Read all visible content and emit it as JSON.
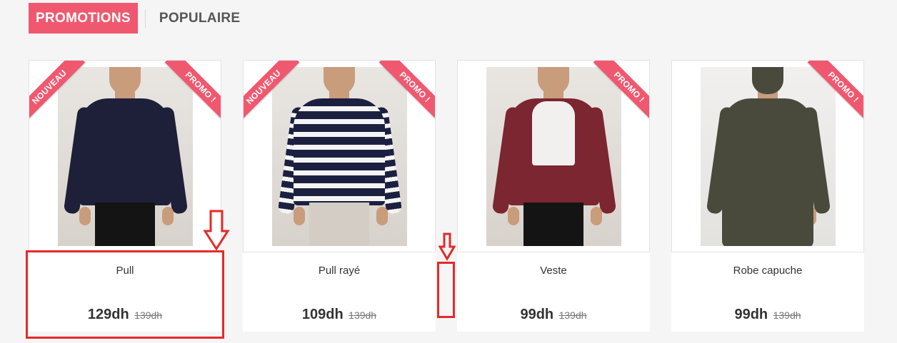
{
  "tabs": {
    "active": "PROMOTIONS",
    "inactive": "POPULAIRE"
  },
  "colors": {
    "accent": "#f0586f",
    "annotation": "#e42a2a"
  },
  "products": [
    {
      "name": "Pull",
      "price": "129dh",
      "old_price": "139dh",
      "badge_new": "NOUVEAU",
      "badge_promo": "PROMO !",
      "garment_color": "#1d2038",
      "garment_icon": "sweater-icon"
    },
    {
      "name": "Pull rayé",
      "price": "109dh",
      "old_price": "139dh",
      "badge_new": "NOUVEAU",
      "badge_promo": "PROMO !",
      "garment_color": "#1c2040",
      "garment_icon": "striped-sweater-icon"
    },
    {
      "name": "Veste",
      "price": "99dh",
      "old_price": "139dh",
      "badge_new": "",
      "badge_promo": "PROMO !",
      "garment_color": "#7b2630",
      "garment_icon": "jacket-icon"
    },
    {
      "name": "Robe capuche",
      "price": "99dh",
      "old_price": "139dh",
      "badge_new": "",
      "badge_promo": "PROMO !",
      "garment_color": "#4a4a3c",
      "garment_icon": "hooded-dress-icon"
    }
  ]
}
